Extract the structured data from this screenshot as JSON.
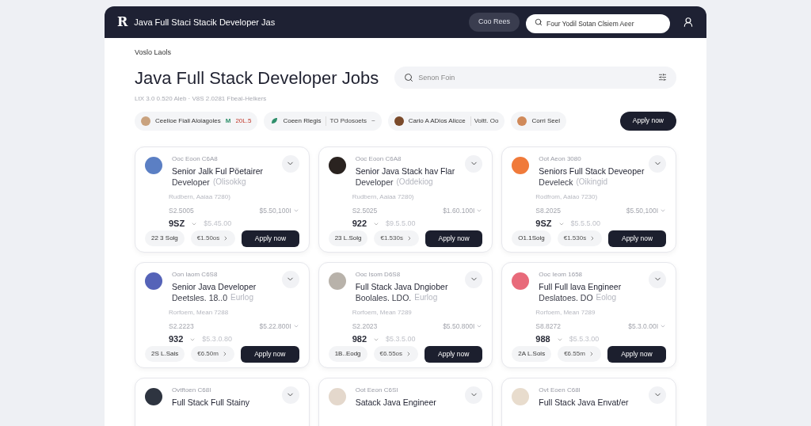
{
  "header": {
    "logo": "R",
    "title": "Java Full Staci Stacik Developer  Jas",
    "button": "Coo Rees",
    "search_placeholder": "Four Yodil Sotan Clsiem Aeer"
  },
  "breadcrumb": "Voslo Laols",
  "heading": "Java Full Stack Developer Jobs",
  "meta": "LtX 3.0 0.520 Aleb ·  V8S 2.0281 Fbeal-Helkers",
  "search": {
    "placeholder": "Senon Foin"
  },
  "filters": [
    {
      "kind": "avatar",
      "label": "Ceelioe Fiali Aloiagoles",
      "extra_icon": "M",
      "extra": "20L.5",
      "color": "#c9a27e"
    },
    {
      "kind": "icon",
      "label": "Coeen Rlegis",
      "extra": "TO Pdosoets",
      "trail": "~",
      "color": "#2f8f6b"
    },
    {
      "kind": "avatar",
      "label": "Cario A ADios Alicce",
      "extra": "Voltt. Oo",
      "color": "#7a4a2a"
    },
    {
      "kind": "avatar",
      "label": "Corri Seel",
      "color": "#d08a5a"
    }
  ],
  "apply_button": "Apply now",
  "cards": [
    {
      "company": "Ooc Eoon C6A8",
      "title": "Senior Jalk Ful Pöetairer",
      "subtitle": "Developer",
      "note": "(Olisokkg",
      "location": "Rudbern, Aaiaa 7280)",
      "salary_small": "S2.5005",
      "salary_range": "$5.50,100I",
      "rating": "9SZ",
      "old_price": "$5.45.00",
      "chip_1": "22 3 Solg",
      "chip_2": "€1.50os",
      "button": "Apply now",
      "color": "#5b7fc4"
    },
    {
      "company": "Ooc Eoon C6A8",
      "title": "Senior Java Stack hav Flar",
      "subtitle": "Developer",
      "note": "(Oddekiog",
      "location": "Rudbern, Aaiaa 7280)",
      "salary_small": "S2.5025",
      "salary_range": "$1.60.100I",
      "rating": "922",
      "old_price": "$9.5.5.00",
      "chip_1": "23 L.Solg",
      "chip_2": "€1.530s",
      "button": "Apply now",
      "color": "#2a2320"
    },
    {
      "company": "Oot Aeon 3080",
      "title": "Seniors Full Stack Deveoper",
      "subtitle": "Develeck",
      "note": "(Oikingid",
      "location": "Rodfrom, Aaiao 7230)",
      "salary_small": "S8.2025",
      "salary_range": "$5.50,100I",
      "rating": "9SZ",
      "old_price": "$5.5.5.00",
      "chip_1": "O1.1Solg",
      "chip_2": "€1.530s",
      "button": "Apply now",
      "color": "#f07a3a"
    },
    {
      "company": "Oon Iaom C6S8",
      "title": "Senior Java Developer",
      "subtitle": "Deetsles. 18..0",
      "note": "Eurlog",
      "location": "Rorfoem, Mean 7288",
      "salary_small": "S2.2223",
      "salary_range": "$5.22.800I",
      "rating": "932",
      "old_price": "$5.3.0.80",
      "chip_1": "2S L.Sais",
      "chip_2": "€6.50m",
      "button": "Apply now",
      "color": "#5563b8"
    },
    {
      "company": "Ooc Isom D6S8",
      "title": "Full Stack Java Dngiober",
      "subtitle": "Boolales. LDO.",
      "note": "Eurlog",
      "location": "Rorfoem, Mean 7289",
      "salary_small": "S2.2023",
      "salary_range": "$5.50.800I",
      "rating": "982",
      "old_price": "$5.3.5.00",
      "chip_1": "1B..Eodg",
      "chip_2": "€6.55os",
      "button": "Apply now",
      "color": "#b8b2aa"
    },
    {
      "company": "Ooc Ieom 1658",
      "title": "Full Full lava Engineer",
      "subtitle": "Deslatoes. DO",
      "note": "Eolog",
      "location": "Rorfoem, Mean 7289",
      "salary_small": "S8.8272",
      "salary_range": "$5.3.0.00I",
      "rating": "988",
      "old_price": "$5.5.3.00",
      "chip_1": "2A L.Sois",
      "chip_2": "€6.55m",
      "button": "Apply now",
      "color": "#e86a7a"
    },
    {
      "company": "Ovtftoen C68I",
      "title": "Full Stack Full Stainy",
      "color": "#2e3440"
    },
    {
      "company": "Oot Eeon C6SI",
      "title": "Satack Java Engineer",
      "color": "#e4d8cc"
    },
    {
      "company": "Ovt Eoen C68I",
      "title": "Full Stack Java Envat/er",
      "color": "#e8dccd"
    }
  ]
}
